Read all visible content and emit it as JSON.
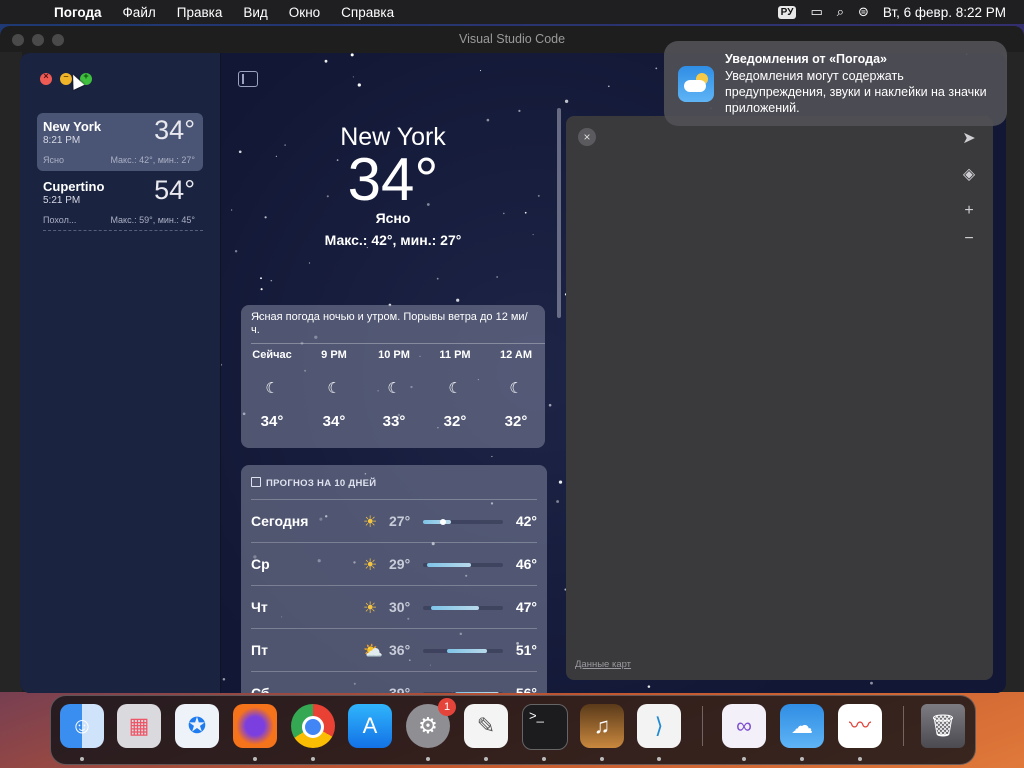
{
  "menubar": {
    "app": "Погода",
    "items": [
      "Файл",
      "Правка",
      "Вид",
      "Окно",
      "Справка"
    ],
    "keyboard": "РУ",
    "clock": "Вт, 6 февр.  8:22 PM"
  },
  "vscode": {
    "title": "Visual Studio Code"
  },
  "sidebar": {
    "cities": [
      {
        "name": "New York",
        "time": "8:21 PM",
        "temp": "34°",
        "condition": "Ясно",
        "hilo": "Макс.: 42°, мин.: 27°"
      },
      {
        "name": "Cupertino",
        "time": "5:21 PM",
        "temp": "54°",
        "condition": "Похол...",
        "hilo": "Макс.: 59°, мин.: 45°"
      }
    ]
  },
  "hero": {
    "city": "New York",
    "temp": "34°",
    "condition": "Ясно",
    "hilo": "Макс.: 42°, мин.: 27°"
  },
  "hourly": {
    "description": "Ясная погода ночью и утром. Порывы ветра до 12 ми/ч.",
    "items": [
      {
        "hour": "Сейчас",
        "icon": "moon-icon",
        "temp": "34°"
      },
      {
        "hour": "9 PM",
        "icon": "moon-icon",
        "temp": "34°"
      },
      {
        "hour": "10 PM",
        "icon": "moon-icon",
        "temp": "33°"
      },
      {
        "hour": "11 PM",
        "icon": "moon-icon",
        "temp": "32°"
      },
      {
        "hour": "12 AM",
        "icon": "moon-icon",
        "temp": "32°"
      }
    ]
  },
  "daily": {
    "header": "ПРОГНОЗ НА 10 ДНЕЙ",
    "rows": [
      {
        "day": "Сегодня",
        "icon": "sun-icon",
        "low": "27°",
        "high": "42°",
        "range_start": 0.0,
        "range_end": 0.35,
        "current": 0.25
      },
      {
        "day": "Ср",
        "icon": "sun-icon",
        "low": "29°",
        "high": "46°",
        "range_start": 0.05,
        "range_end": 0.6
      },
      {
        "day": "Чт",
        "icon": "sun-icon",
        "low": "30°",
        "high": "47°",
        "range_start": 0.1,
        "range_end": 0.7
      },
      {
        "day": "Пт",
        "icon": "partly-cloudy-icon",
        "low": "36°",
        "high": "51°",
        "range_start": 0.3,
        "range_end": 0.8
      },
      {
        "day": "Сб",
        "icon": "cloud-icon",
        "low": "39°",
        "high": "56°",
        "range_start": 0.4,
        "range_end": 0.95
      }
    ]
  },
  "map": {
    "attribution": "Данные карт"
  },
  "notification": {
    "title": "Уведомления от «Погода»",
    "body": "Уведомления могут содержать предупреждения, звуки и наклейки на значки приложений."
  },
  "dock": {
    "apps": [
      "finder-icon",
      "launchpad-icon",
      "safari-icon",
      "firefox-icon",
      "chrome-icon",
      "app-store-icon",
      "system-settings-icon",
      "textedit-icon",
      "terminal-icon",
      "instruments-icon",
      "vscode-icon",
      "visual-studio-icon",
      "weather-icon",
      "freeform-icon",
      "trash-icon"
    ],
    "settings_badge": "1"
  }
}
